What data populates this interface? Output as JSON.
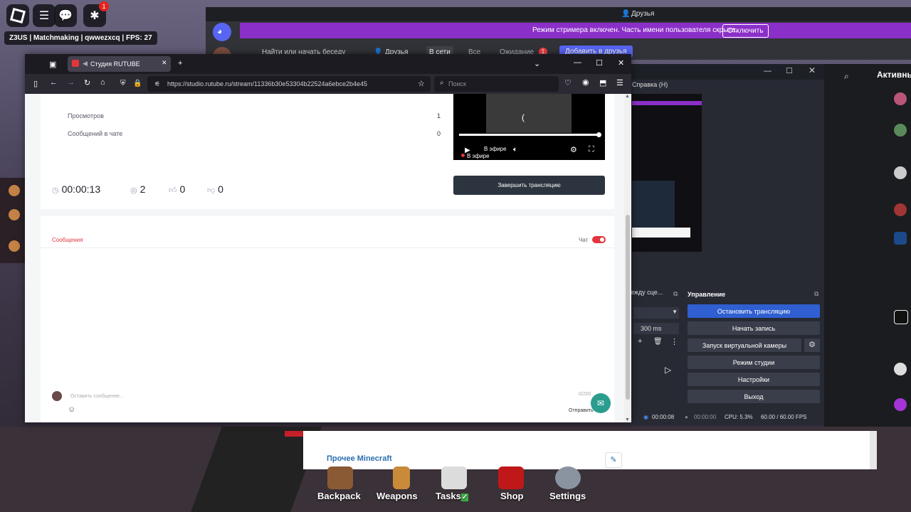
{
  "roblox": {
    "badge_count": "1",
    "server_label": "Z3US | Matchmaking | qwwezxcq | FPS: 27"
  },
  "discord": {
    "friends_title": "Друзья",
    "banner_text": "Режим стримера включен. Часть имени пользователя скрыта.",
    "banner_button": "Отключить",
    "search_placeholder": "Найти или начать беседу",
    "nav_friends": "Друзья",
    "nav_online": "В сети",
    "nav_all": "Все",
    "nav_pending": "Ожидание",
    "nav_pending_count": "1",
    "nav_add": "Добавить в друзья",
    "active_title": "Активны"
  },
  "browser": {
    "tab_title": "Студия RUTUBE",
    "url": "https://studio.rutube.ru/stream/11336b30e53304b22524a6ebce2b4e45",
    "search_placeholder": "Поиск"
  },
  "stream": {
    "views_label": "Просмотров",
    "views_value": "1",
    "chat_messages_label": "Сообщений в чате",
    "chat_messages_value": "0",
    "duration": "00:00:13",
    "viewers": "2",
    "likes": "0",
    "dislikes": "0",
    "end_button": "Завершить трансляцию",
    "live_label": "В эфире",
    "video_progress": 1.0,
    "messages_tab": "Сообщения",
    "chat_toggle_label": "Чат",
    "message_placeholder": "Оставить сообщение...",
    "char_counter": "0/200",
    "send_label": "Отправить"
  },
  "obs": {
    "help_menu": "Справка (H)",
    "transitions_title": "ежду сце...",
    "duration_value": "300 ms",
    "controls_title": "Управление",
    "btn_stop_stream": "Остановить трансляцию",
    "btn_start_recording": "Начать запись",
    "btn_virtual_cam": "Запуск виртуальной камеры",
    "btn_studio_mode": "Режим студии",
    "btn_settings": "Настройки",
    "btn_exit": "Выход",
    "status_stream_time": "00:00:08",
    "status_rec_time": "00:00:00",
    "status_cpu": "CPU: 5.3%",
    "status_fps": "60.00 / 60.00 FPS"
  },
  "minecraft_panel": {
    "title": "Прочее Minecraft"
  },
  "game_menu": {
    "backpack": "Backpack",
    "weapons": "Weapons",
    "tasks": "Tasks",
    "shop": "Shop",
    "settings": "Settings"
  },
  "colors": {
    "discord_banner": "#8b2fc9",
    "obs_active_button": "#2f5fd1",
    "rutube_accent": "#e2353c",
    "end_button_bg": "#2c343f"
  }
}
